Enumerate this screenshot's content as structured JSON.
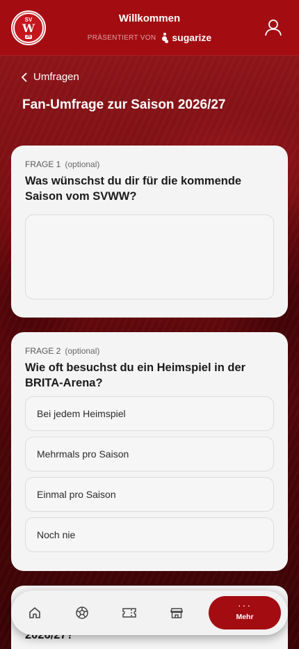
{
  "header": {
    "title": "Willkommen",
    "presented_by": "PRÄSENTIERT VON",
    "sponsor": "sugarize",
    "logo_text": {
      "top": "SV",
      "mid": "W",
      "num": "26"
    }
  },
  "nav_back": {
    "label": "Umfragen"
  },
  "page": {
    "title": "Fan-Umfrage zur Saison 2026/27"
  },
  "questions": [
    {
      "label": "FRAGE 1",
      "optional": "(optional)",
      "text": "Was wünschst du dir für die kommende Saison vom SVWW?",
      "type": "text",
      "value": ""
    },
    {
      "label": "FRAGE 2",
      "optional": "(optional)",
      "text": "Wie oft besuchst du ein Heimspiel in der BRITA-Arena?",
      "type": "choice",
      "options": [
        "Bei jedem Heimspiel",
        "Mehrmals pro Saison",
        "Einmal pro Saison",
        "Noch nie"
      ]
    },
    {
      "partial_text": "2026/27?"
    }
  ],
  "bottom_nav": {
    "items": [
      "home-icon",
      "football-icon",
      "ticket-icon",
      "shop-icon"
    ],
    "active": {
      "label": "Mehr",
      "icon": "more-dots-icon"
    }
  },
  "colors": {
    "brand": "#a30d12",
    "card": "#f5f4f4"
  }
}
